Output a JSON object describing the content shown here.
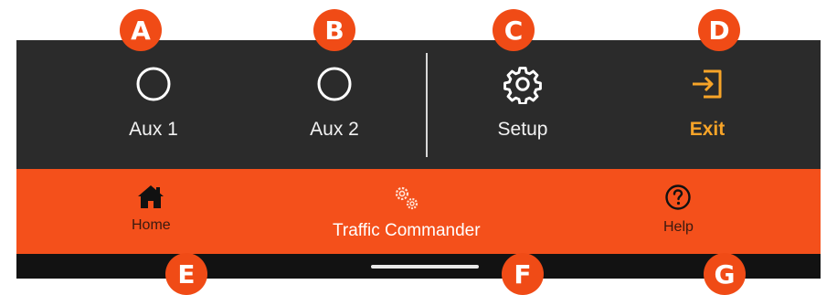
{
  "top_buttons": [
    {
      "label": "Aux 1",
      "icon": "circle-outline-icon"
    },
    {
      "label": "Aux 2",
      "icon": "circle-outline-icon"
    },
    {
      "label": "Setup",
      "icon": "gear-icon"
    },
    {
      "label": "Exit",
      "icon": "exit-icon"
    }
  ],
  "nav": {
    "home": {
      "label": "Home",
      "icon": "house-icon"
    },
    "app": {
      "label": "Traffic Commander",
      "icon": "gears-icon"
    },
    "help": {
      "label": "Help",
      "icon": "question-circle-icon"
    }
  },
  "callouts": [
    "A",
    "B",
    "C",
    "D",
    "E",
    "F",
    "G"
  ],
  "colors": {
    "panel": "#2b2b2b",
    "nav_bar": "#f4501b",
    "accent_exit": "#f7a428",
    "callout": "#f04b16"
  }
}
